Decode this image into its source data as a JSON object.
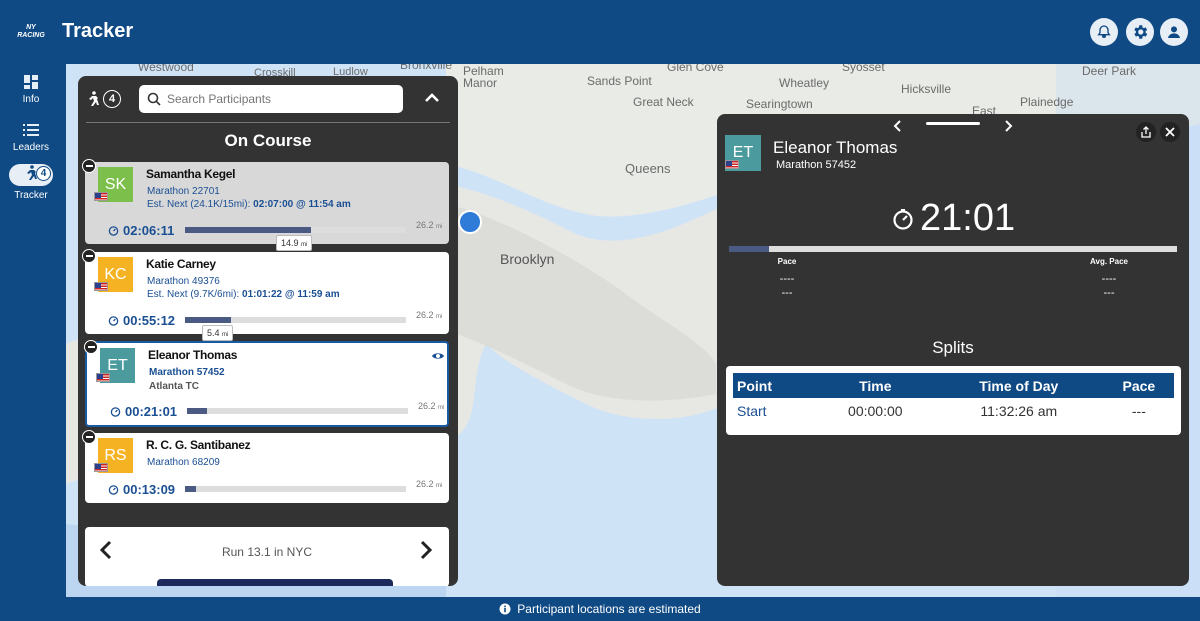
{
  "app": {
    "logo_text": "NY RACING",
    "title": "Tracker"
  },
  "nav": {
    "items": [
      {
        "label": "Info",
        "icon": "dashboard-icon"
      },
      {
        "label": "Leaders",
        "icon": "list-icon"
      },
      {
        "label": "Tracker",
        "icon": "runner-icon",
        "badge": "4"
      }
    ]
  },
  "header_icons": [
    "bell-icon",
    "gear-icon",
    "user-icon"
  ],
  "map": {
    "labels": [
      "Westwood",
      "Crosskill",
      "Ludlow",
      "Bronxville",
      "Pelham Manor",
      "Sands Point",
      "Glen Cove",
      "Syosset",
      "Deer Park",
      "Wheatley",
      "Hicksville",
      "Great Neck",
      "Searingtown",
      "Plainedge",
      "East",
      "Queens",
      "Brooklyn"
    ]
  },
  "tracker_panel": {
    "runner_count": "4",
    "search_placeholder": "Search Participants",
    "section_title": "On Course",
    "participants": [
      {
        "initials": "SK",
        "name": "Samantha Kegel",
        "event": "Marathon 22701",
        "est_label": "Est. Next (24.1K/15mi):",
        "est_value": "02:07:00 @ 11:54 am",
        "elapsed": "02:06:11",
        "progress_pct": 57,
        "total": "26.2",
        "unit": "mi",
        "mile_marker": "14.9",
        "avatar_color": "#7cbf4a",
        "highlight": true
      },
      {
        "initials": "KC",
        "name": "Katie Carney",
        "event": "Marathon 49376",
        "est_label": "Est. Next (9.7K/6mi):",
        "est_value": "01:01:22 @ 11:59 am",
        "elapsed": "00:55:12",
        "progress_pct": 21,
        "total": "26.2",
        "unit": "mi",
        "mile_marker": "5.4",
        "avatar_color": "#f5b324"
      },
      {
        "initials": "ET",
        "name": "Eleanor Thomas",
        "event": "Marathon 57452",
        "team": "Atlanta TC",
        "elapsed": "00:21:01",
        "progress_pct": 9,
        "total": "26.2",
        "unit": "mi",
        "avatar_color": "#4a9a9e",
        "selected": true
      },
      {
        "initials": "RS",
        "name": "R. C. G. Santibanez",
        "event": "Marathon 68209",
        "elapsed": "00:13:09",
        "progress_pct": 5,
        "total": "26.2",
        "unit": "mi",
        "avatar_color": "#f5b324"
      }
    ],
    "event_selector": "Run 13.1 in NYC"
  },
  "detail_panel": {
    "initials": "ET",
    "name": "Eleanor Thomas",
    "event": "Marathon 57452",
    "clock": "21:01",
    "progress_pct": 9,
    "pace_label": "Pace",
    "pace_value": "----",
    "pace_sub": "---",
    "avg_pace_label": "Avg. Pace",
    "avg_pace_value": "----",
    "avg_pace_sub": "---",
    "splits_title": "Splits",
    "splits_headers": [
      "Point",
      "Time",
      "Time of Day",
      "Pace"
    ],
    "splits_rows": [
      {
        "point": "Start",
        "time": "00:00:00",
        "time_of_day": "11:32:26 am",
        "pace": "---"
      }
    ]
  },
  "footer": {
    "notice": "Participant locations are estimated"
  }
}
